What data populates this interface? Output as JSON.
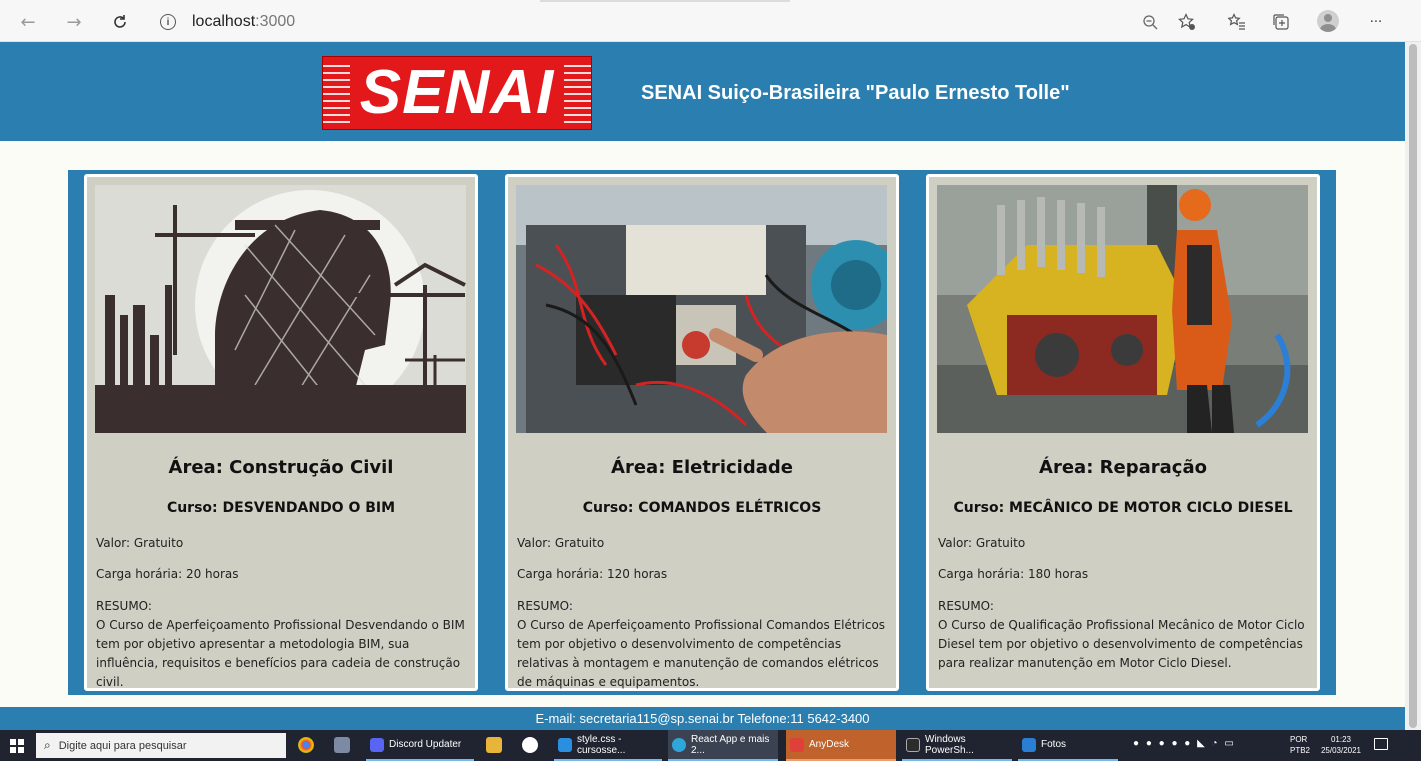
{
  "browser": {
    "url_host": "localhost",
    "url_port": ":3000",
    "more_label": "···"
  },
  "header": {
    "logo_text": "SENAI",
    "title": "SENAI Suiço-Brasileira \"Paulo Ernesto Tolle\""
  },
  "courses": [
    {
      "area": "Área: Construção Civil",
      "course": "Curso: DESVENDANDO O BIM",
      "price": "Valor: Gratuito",
      "hours": "Carga horária: 20 horas",
      "summary_label": "RESUMO:",
      "summary": "O Curso de Aperfeiçoamento Profissional Desvendando o BIM tem por objetivo apresentar a metodologia BIM, sua influência, requisitos e benefícios para cadeia de construção civil."
    },
    {
      "area": "Área: Eletricidade",
      "course": "Curso: COMANDOS ELÉTRICOS",
      "price": "Valor: Gratuito",
      "hours": "Carga horária: 120 horas",
      "summary_label": "RESUMO:",
      "summary": "O Curso de Aperfeiçoamento Profissional Comandos Elétricos tem por objetivo o desenvolvimento de competências relativas à montagem e manutenção de comandos elétricos de máquinas e equipamentos."
    },
    {
      "area": "Área: Reparação",
      "course": "Curso: MECÂNICO DE MOTOR CICLO DIESEL",
      "price": "Valor: Gratuito",
      "hours": "Carga horária: 180 horas",
      "summary_label": "RESUMO:",
      "summary": "O Curso de Qualificação Profissional Mecânico de Motor Ciclo Diesel tem por objetivo o desenvolvimento de competências para realizar manutenção em Motor Ciclo Diesel."
    }
  ],
  "footer": {
    "contact": "E-mail: secretaria115@sp.senai.br Telefone:11 5642-3400"
  },
  "taskbar": {
    "search_placeholder": "Digite aqui para pesquisar",
    "apps": [
      {
        "label": "Discord Updater",
        "color": "#5865f2"
      },
      {
        "label": "style.css - cursosse...",
        "color": "#2b8fe0"
      },
      {
        "label": "React App e mais 2...",
        "color": "#2fa6d9"
      },
      {
        "label": "AnyDesk",
        "color": "#e0403a"
      },
      {
        "label": "Windows PowerSh...",
        "color": "#2c2c2c"
      },
      {
        "label": "Fotos",
        "color": "#2a7fd4"
      }
    ],
    "lang_1": "POR",
    "lang_2": "PTB2",
    "time": "01:23",
    "date": "25/03/2021"
  },
  "colors": {
    "header_blue": "#2a7fb0",
    "card_bg": "#cfcfc4",
    "logo_red": "#e3181b"
  }
}
